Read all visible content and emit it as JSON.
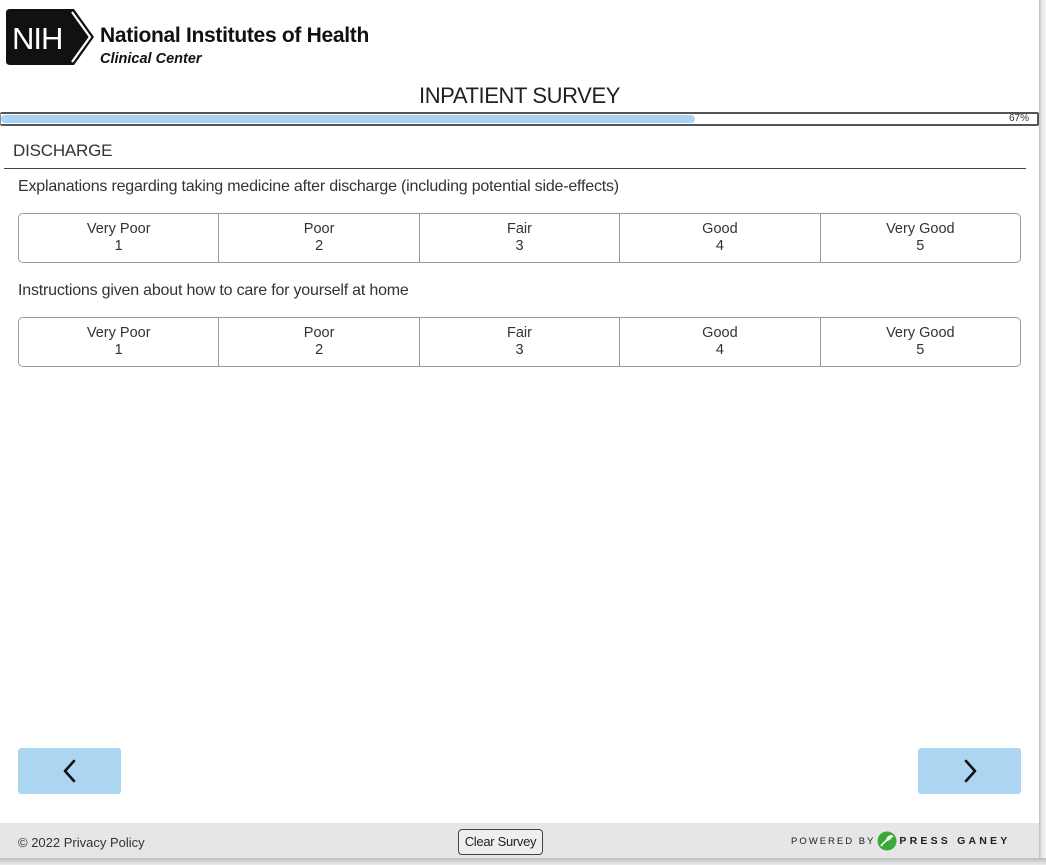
{
  "header": {
    "logo_badge_text": "NIH",
    "logo_title": "National Institutes of Health",
    "logo_subtitle": "Clinical Center"
  },
  "survey": {
    "title": "INPATIENT SURVEY",
    "progress_percent": 67,
    "progress_label": "67%"
  },
  "section": {
    "title": "DISCHARGE"
  },
  "questions": [
    {
      "text": "Explanations regarding taking medicine after discharge (including potential side-effects)",
      "options": [
        {
          "label": "Very Poor",
          "value": "1"
        },
        {
          "label": "Poor",
          "value": "2"
        },
        {
          "label": "Fair",
          "value": "3"
        },
        {
          "label": "Good",
          "value": "4"
        },
        {
          "label": "Very Good",
          "value": "5"
        }
      ]
    },
    {
      "text": "Instructions given about how to care for yourself at home",
      "options": [
        {
          "label": "Very Poor",
          "value": "1"
        },
        {
          "label": "Poor",
          "value": "2"
        },
        {
          "label": "Fair",
          "value": "3"
        },
        {
          "label": "Good",
          "value": "4"
        },
        {
          "label": "Very Good",
          "value": "5"
        }
      ]
    }
  ],
  "navigation": {
    "back_icon": "chevron-left-icon",
    "next_icon": "chevron-right-icon",
    "button_color": "#acd5f1"
  },
  "footer": {
    "copyright": "© 2022 Privacy Policy",
    "clear_survey": "Clear Survey",
    "powered_by": "POWERED BY",
    "vendor": "PRESS GANEY",
    "vendor_icon": "press-ganey-leaf-icon"
  },
  "colors": {
    "progress_fill": "#a9d3f2",
    "footer_bg": "#e6e6e6",
    "vendor_green": "#3aa935"
  }
}
